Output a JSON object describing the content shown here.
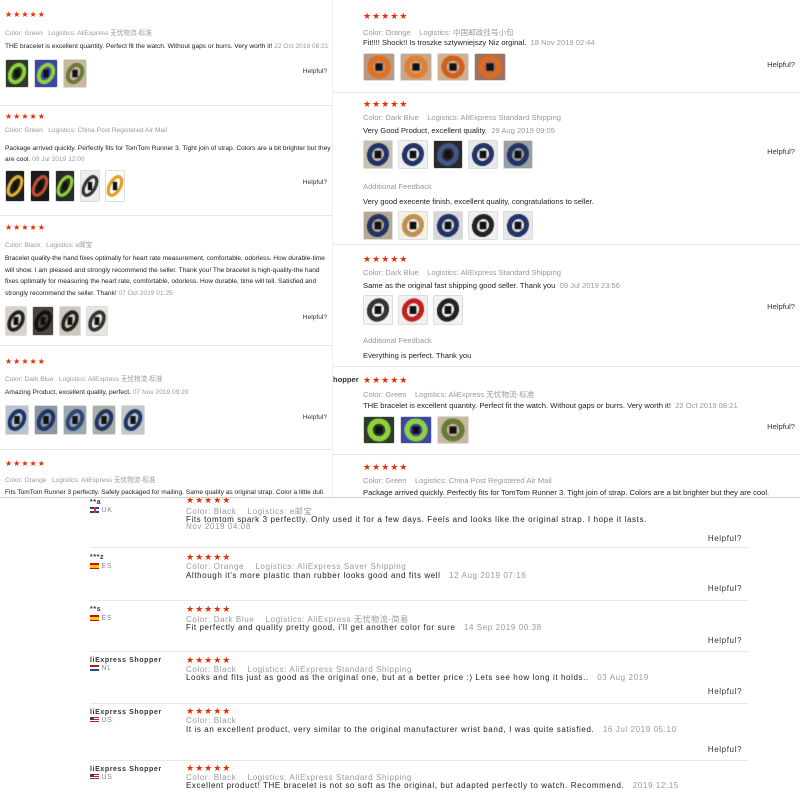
{
  "labels": {
    "color": "Color:",
    "logistics": "Logistics:",
    "helpful": "Helpful?",
    "additional": "Additional Feedback"
  },
  "left": [
    {
      "stars": "★★★★★",
      "color": "Green",
      "logistics": "AliExpress 无忧物流-标准",
      "text": "THE bracelet is excellent quantity. Perfect fit the watch. Without gaps or burrs. Very worth it!",
      "date": "22 Oct 2019 08:21",
      "photos": [
        {
          "bg": "#2e3b2a",
          "accent": "#8fd13c"
        },
        {
          "bg": "#3b46a8",
          "accent": "#8fd13c"
        },
        {
          "bg": "#c9b8a0",
          "accent": "#6a7a3a"
        }
      ]
    },
    {
      "stars": "★★★★★",
      "color": "Green",
      "logistics": "China Post Registered Air Mail",
      "text": "Package arrived quickly. Perfectly fits for TomTom Runner 3. Tight join of strap. Colors are a bit brighter but they are cool.",
      "date": "09 Jul 2019 12:00",
      "photos": [
        {
          "bg": "#1f1f1f",
          "accent": "#e0b030"
        },
        {
          "bg": "#1a1a1a",
          "accent": "#c05030"
        },
        {
          "bg": "#2a2a2a",
          "accent": "#8fd13c"
        },
        {
          "bg": "#eeeeee",
          "accent": "#333333"
        },
        {
          "bg": "#ffffff",
          "accent": "#e0a020"
        }
      ]
    },
    {
      "stars": "★★★★★",
      "color": "Black",
      "logistics": "e邮宝",
      "text": "Bracelet quality-the hand fixes optimally for heart rate measurement, comfortable, odorless. How durable-time will show. I am pleased and strongly recommend the seller. Thank you! The bracelet is high-quality-the hand fixes optimally for measuring the heart rate, comfortable, odorless. How durable, time will tell. Satisfied and strongly recommend the seller. Thank!",
      "date": "07 Oct 2019 01:25",
      "photos": [
        {
          "bg": "#d8d2c8",
          "accent": "#222222"
        },
        {
          "bg": "#4a4540",
          "accent": "#111111"
        },
        {
          "bg": "#cfc8bc",
          "accent": "#222222"
        },
        {
          "bg": "#e8e4de",
          "accent": "#333333"
        }
      ]
    },
    {
      "stars": "★★★★★",
      "color": "Dark Blue",
      "logistics": "AliExpress 无忧物流-标准",
      "text": "Amazing Product, excellent quality, perfect.",
      "date": "07 Nov 2019 09:28",
      "photos": [
        {
          "bg": "#b8c4cc",
          "accent": "#223366"
        },
        {
          "bg": "#8a96a0",
          "accent": "#223366"
        },
        {
          "bg": "#9aa8b0",
          "accent": "#334477"
        },
        {
          "bg": "#a8b0a8",
          "accent": "#223366"
        },
        {
          "bg": "#c0c8c8",
          "accent": "#223366"
        }
      ]
    },
    {
      "stars": "★★★★★",
      "color": "Orange",
      "logistics": "AliExpress 无忧物流-标准",
      "text": "Fits TomTom Runner 3 perfectly. Safely packaged for mailing. Same quality as original strap. Color a little dull."
    }
  ],
  "right": [
    {
      "stars": "★★★★★",
      "color": "Orange",
      "logistics": "中国邮政挂号小包",
      "text": "Fit!!!! Shock!! Is troszke sztywniejszy Niz orginal.",
      "date": "18 Nov 2019 02:44",
      "photos": [
        {
          "bg": "#b89880",
          "accent": "#e07020"
        },
        {
          "bg": "#c8a888",
          "accent": "#e08030"
        },
        {
          "bg": "#d0b090",
          "accent": "#d06020"
        },
        {
          "bg": "#a07060",
          "accent": "#e06a20"
        }
      ]
    },
    {
      "stars": "★★★★★",
      "color": "Dark Blue",
      "logistics": "AliExpress Standard Shipping",
      "text": "Very Good Product, excellent quality.",
      "date": "29 Aug 2019 09:05",
      "photos": [
        {
          "bg": "#c8c0b0",
          "accent": "#223366"
        },
        {
          "bg": "#f0f0f0",
          "accent": "#223366"
        },
        {
          "bg": "#2a2a2a",
          "accent": "#445588"
        },
        {
          "bg": "#e8e8e8",
          "accent": "#223366"
        },
        {
          "bg": "#9aa0a0",
          "accent": "#223366"
        }
      ],
      "additional": {
        "text": "Very good execente finish, excellent quality, congratulations to seller.",
        "photos": [
          {
            "bg": "#b8a890",
            "accent": "#223366"
          },
          {
            "bg": "#f4f0e8",
            "accent": "#c09050"
          },
          {
            "bg": "#d8d8d8",
            "accent": "#223366"
          },
          {
            "bg": "#f0f0f0",
            "accent": "#222222"
          },
          {
            "bg": "#e8e8e8",
            "accent": "#223366"
          }
        ]
      }
    },
    {
      "stars": "★★★★★",
      "color": "Dark Blue",
      "logistics": "AliExpress Standard Shipping",
      "text": "Same as the original fast shipping good seller. Thank you",
      "date": "09 Jul 2019 23:56",
      "photos": [
        {
          "bg": "#f4f4f4",
          "accent": "#333333"
        },
        {
          "bg": "#f0eeee",
          "accent": "#c02020"
        },
        {
          "bg": "#f2f2f2",
          "accent": "#222222"
        }
      ],
      "additional": {
        "text": "Everything is perfect. Thank you",
        "photos": []
      }
    },
    {
      "stars": "★★★★★",
      "color": "Green",
      "logistics": "AliExpress 无忧物流-标准",
      "text": "THE bracelet is excellent quantity. Perfect fit the watch. Without gaps or burrs. Very worth it!",
      "date": "22 Oct 2019 08:21",
      "photos": [
        {
          "bg": "#2e3b2a",
          "accent": "#8fd13c"
        },
        {
          "bg": "#3b46a8",
          "accent": "#8fd13c"
        },
        {
          "bg": "#c9b8a0",
          "accent": "#6a7a3a"
        }
      ]
    },
    {
      "stars": "★★★★★",
      "color": "Green",
      "logistics": "China Post Registered Air Mail",
      "text": "Package arrived quickly. Perfectly fits for TomTom Runner 3. Tight join of strap. Colors are a bit brighter but they are cool."
    }
  ],
  "right_fragment": "hopper",
  "bottom": [
    {
      "user": "**a",
      "country": "UK",
      "flag": "uk",
      "stars": "★★★★★",
      "color": "Black",
      "logistics": "e邮宝",
      "text": "Fits tomtom spark 3 perfectly. Only used it for a few days. Feels and looks like the original strap. I hope it lasts.",
      "date": "Nov 2019 04:08"
    },
    {
      "user": "***z",
      "country": "ES",
      "flag": "es",
      "stars": "★★★★★",
      "color": "Orange",
      "logistics": "AliExpress Saver Shipping",
      "text": "Although it's more plastic than rubber looks good and fits well",
      "date": "12 Aug 2019 07:16"
    },
    {
      "user": "**s",
      "country": "ES",
      "flag": "es",
      "stars": "★★★★★",
      "color": "Dark Blue",
      "logistics": "AliExpress 无忧物流-简易",
      "text": "Fit perfectly and quality pretty good, i'll get another color for sure",
      "date": "14 Sep 2019 00:38"
    },
    {
      "user": "liExpress Shopper",
      "country": "NL",
      "flag": "nl",
      "stars": "★★★★★",
      "color": "Black",
      "logistics": "AliExpress Standard Shipping",
      "text": "Looks and fits just as good as the original one, but at a better price :) Lets see how long it holds..",
      "date": "03 Aug 2019"
    },
    {
      "user": "liExpress Shopper",
      "country": "US",
      "flag": "us",
      "stars": "★★★★★",
      "color": "Black",
      "logistics": "",
      "text": "It is an excellent product, very similar to the original manufacturer wrist band, I was quite satisfied.",
      "date": "16 Jul 2019 05:10"
    },
    {
      "user": "liExpress Shopper",
      "country": "US",
      "flag": "us",
      "stars": "★★★★★",
      "color": "Black",
      "logistics": "AliExpress Standard Shipping",
      "text": "Excellent product! THE bracelet is not so soft as the original, but adapted perfectly to watch. Recommend.",
      "date": "2019 12:15"
    }
  ]
}
